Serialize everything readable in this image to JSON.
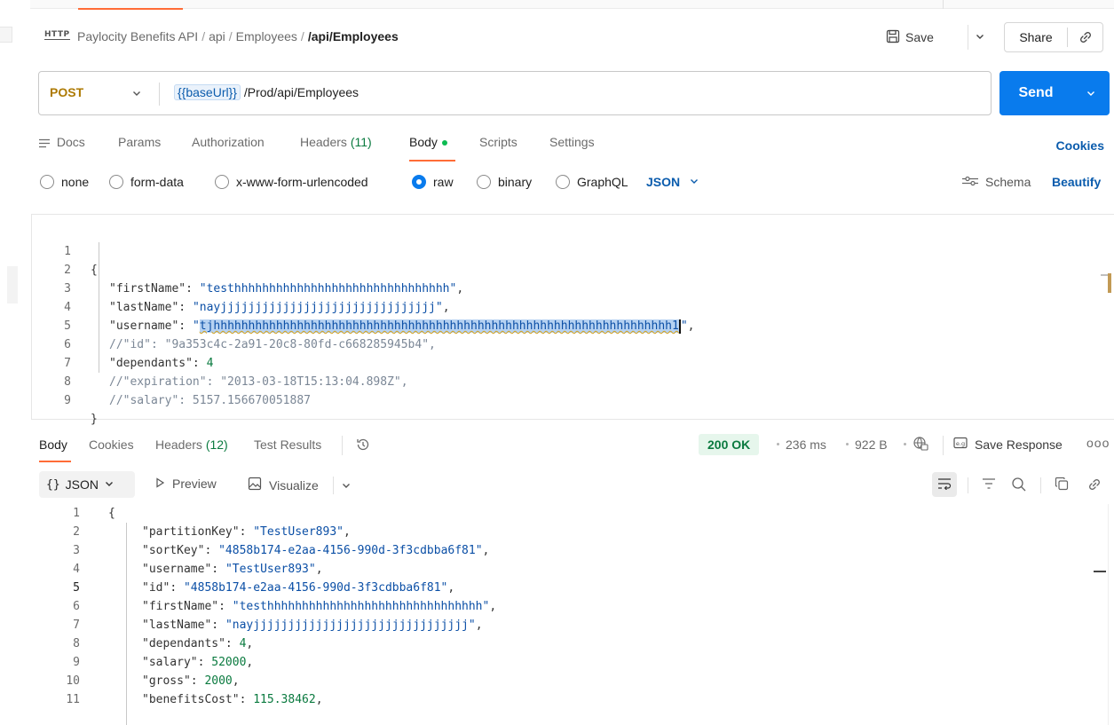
{
  "breadcrumb": {
    "protocol_badge": "HTTP",
    "items": [
      "Paylocity Benefits API",
      "api",
      "Employees"
    ],
    "current": "/api/Employees",
    "separator": "/"
  },
  "header_actions": {
    "save_label": "Save",
    "share_label": "Share"
  },
  "request": {
    "method": "POST",
    "url_variable": "{{baseUrl}}",
    "url_path": "/Prod/api/Employees",
    "send_label": "Send"
  },
  "request_tabs": {
    "docs": "Docs",
    "params": "Params",
    "authorization": "Authorization",
    "headers_label": "Headers",
    "headers_count": "(11)",
    "body": "Body",
    "scripts": "Scripts",
    "settings": "Settings",
    "cookies": "Cookies"
  },
  "body_types": {
    "none": "none",
    "form_data": "form-data",
    "urlencoded": "x-www-form-urlencoded",
    "raw": "raw",
    "binary": "binary",
    "graphql": "GraphQL",
    "selected": "raw",
    "format": "JSON",
    "schema": "Schema",
    "beautify": "Beautify"
  },
  "request_body": {
    "line_numbers": [
      "1",
      "2",
      "3",
      "4",
      "5",
      "6",
      "7",
      "8",
      "9"
    ],
    "open_brace": "{",
    "close_brace": "}",
    "first_name_key": "\"firstName\"",
    "first_name_value": "\"testhhhhhhhhhhhhhhhhhhhhhhhhhhhhhhh\"",
    "last_name_key": "\"lastName\"",
    "last_name_value": "\"nayjjjjjjjjjjjjjjjjjjjjjjjjjjjjjjj\"",
    "username_key": "\"username\"",
    "username_value_open": "\"",
    "username_value_selected": "tjhhhhhhhhhhhhhhhhhhhhhhhhhhhhhhhhhhhhhhhhhhhhhhhhhhhhhhhhhhhhhhhhhh1",
    "username_value_close": "\"",
    "id_comment": "//\"id\": \"9a353c4c-2a91-20c8-80fd-c668285945b4\",",
    "dependants_key": "\"dependants\"",
    "dependants_value": "4",
    "expiration_comment": "//\"expiration\": \"2013-03-18T15:13:04.898Z\",",
    "salary_comment": "//\"salary\": 5157.156670051887"
  },
  "response_tabs": {
    "body": "Body",
    "cookies": "Cookies",
    "headers_label": "Headers",
    "headers_count": "(12)",
    "test_results": "Test Results"
  },
  "response_status": {
    "status": "200 OK",
    "time": "236 ms",
    "size": "922 B",
    "save_response": "Save Response",
    "more": "ooo"
  },
  "response_toolbar": {
    "format": "JSON",
    "format_braces": "{}",
    "preview": "Preview",
    "visualize": "Visualize"
  },
  "response_body": {
    "active_line": "5",
    "lines": [
      {
        "n": "1",
        "text": "{"
      },
      {
        "n": "2",
        "key": "\"partitionKey\"",
        "value": "\"TestUser893\"",
        "type": "str",
        "trail": ","
      },
      {
        "n": "3",
        "key": "\"sortKey\"",
        "value": "\"4858b174-e2aa-4156-990d-3f3cdbba6f81\"",
        "type": "str",
        "trail": ","
      },
      {
        "n": "4",
        "key": "\"username\"",
        "value": "\"TestUser893\"",
        "type": "str",
        "trail": ","
      },
      {
        "n": "5",
        "key": "\"id\"",
        "value": "\"4858b174-e2aa-4156-990d-3f3cdbba6f81\"",
        "type": "str",
        "trail": ","
      },
      {
        "n": "6",
        "key": "\"firstName\"",
        "value": "\"testhhhhhhhhhhhhhhhhhhhhhhhhhhhhhhh\"",
        "type": "str",
        "trail": ","
      },
      {
        "n": "7",
        "key": "\"lastName\"",
        "value": "\"nayjjjjjjjjjjjjjjjjjjjjjjjjjjjjjjj\"",
        "type": "str",
        "trail": ","
      },
      {
        "n": "8",
        "key": "\"dependants\"",
        "value": "4",
        "type": "num",
        "trail": ","
      },
      {
        "n": "9",
        "key": "\"salary\"",
        "value": "52000",
        "type": "num",
        "trail": ","
      },
      {
        "n": "10",
        "key": "\"gross\"",
        "value": "2000",
        "type": "num",
        "trail": ","
      },
      {
        "n": "11",
        "key": "\"benefitsCost\"",
        "value": "115.38462",
        "type": "num",
        "trail": ","
      }
    ]
  },
  "colors": {
    "accent": "#ff6c37",
    "send": "#097bed",
    "method_post": "#ad7a03",
    "status_ok": "#0a7a3f",
    "link": "#0b5cad"
  }
}
